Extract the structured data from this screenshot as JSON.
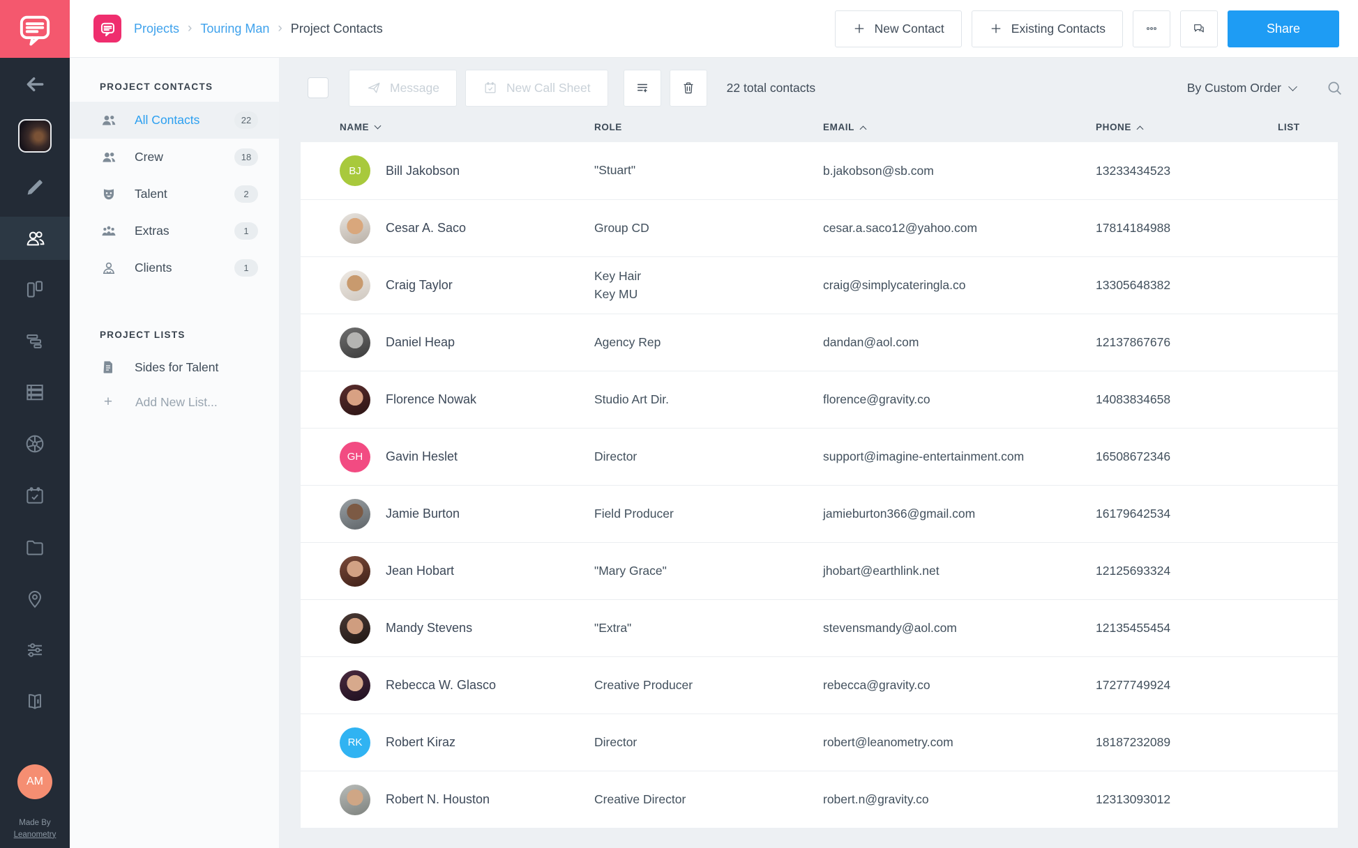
{
  "colors": {
    "brand_pink": "#f4586e",
    "breadcrumb_logo_pink": "#ef2e6e",
    "accent_blue": "#1e9cf4",
    "link_blue": "#3fa2ec",
    "active_filter_blue": "#2b9ff0"
  },
  "header": {
    "breadcrumb": {
      "link1": "Projects",
      "link2": "Touring Man",
      "current": "Project Contacts",
      "separator": "›"
    },
    "new_contact_label": "New Contact",
    "existing_contacts_label": "Existing Contacts",
    "share_label": "Share"
  },
  "left_rail": {
    "icons": [
      "back-arrow",
      "project-thumbnail",
      "pencil",
      "contacts",
      "boards",
      "breakdown",
      "stripboard",
      "shot-list",
      "calendar",
      "files",
      "locations",
      "settings",
      "help-book"
    ],
    "active_icon": "contacts",
    "user_initials": "AM",
    "made_by_line1": "Made By",
    "made_by_line2": "Leanometry"
  },
  "sidebar": {
    "contacts_section_title": "PROJECT CONTACTS",
    "filters": [
      {
        "label": "All Contacts",
        "count": "22",
        "icon": "group",
        "active": true
      },
      {
        "label": "Crew",
        "count": "18",
        "icon": "crew",
        "active": false
      },
      {
        "label": "Talent",
        "count": "2",
        "icon": "talent",
        "active": false
      },
      {
        "label": "Extras",
        "count": "1",
        "icon": "extras",
        "active": false
      },
      {
        "label": "Clients",
        "count": "1",
        "icon": "client",
        "active": false
      }
    ],
    "lists_section_title": "PROJECT LISTS",
    "lists": [
      {
        "label": "Sides for Talent",
        "icon": "document"
      }
    ],
    "add_new_list_plus": "+",
    "add_new_list": "Add New List..."
  },
  "toolbar": {
    "message_label": "Message",
    "new_call_sheet_label": "New Call Sheet",
    "total_text": "22 total contacts",
    "sort_label": "By Custom Order"
  },
  "table": {
    "columns": [
      {
        "label": "NAME",
        "sort": "down"
      },
      {
        "label": "ROLE",
        "sort": ""
      },
      {
        "label": "EMAIL",
        "sort": "up"
      },
      {
        "label": "PHONE",
        "sort": "up"
      },
      {
        "label": "LIST",
        "sort": ""
      }
    ],
    "rows": [
      {
        "name": "Bill Jakobson",
        "role": "\"Stuart\"",
        "email": "b.jakobson@sb.com",
        "phone": "13233434523",
        "list": "",
        "avatar": {
          "type": "initials",
          "text": "BJ",
          "color": "#a8c93c"
        }
      },
      {
        "name": "Cesar A. Saco",
        "role": "Group CD",
        "email": "cesar.a.saco12@yahoo.com",
        "phone": "17814184988",
        "list": "",
        "avatar": {
          "type": "photo",
          "skin": "#d9a77c",
          "bg1": "#e8e4df",
          "bg2": "#b9b0a6"
        }
      },
      {
        "name": "Craig Taylor",
        "role": "Key Hair\nKey MU",
        "email": "craig@simplycateringla.co",
        "phone": "13305648382",
        "list": "",
        "avatar": {
          "type": "photo",
          "skin": "#c89a6e",
          "bg1": "#efeae4",
          "bg2": "#cfc8c0"
        }
      },
      {
        "name": "Daniel Heap",
        "role": "Agency Rep",
        "email": "dandan@aol.com",
        "phone": "12137867676",
        "list": "",
        "avatar": {
          "type": "photo",
          "skin": "#b4b4b2",
          "bg1": "#6f6f6f",
          "bg2": "#3c3c3c"
        }
      },
      {
        "name": "Florence Nowak",
        "role": "Studio Art Dir.",
        "email": "florence@gravity.co",
        "phone": "14083834658",
        "list": "",
        "avatar": {
          "type": "photo",
          "skin": "#d8a183",
          "bg1": "#5a2d2d",
          "bg2": "#2b1414"
        }
      },
      {
        "name": "Gavin Heslet",
        "role": "Director",
        "email": "support@imagine-entertainment.com",
        "phone": "16508672346",
        "list": "",
        "avatar": {
          "type": "initials",
          "text": "GH",
          "color": "#f24b82"
        }
      },
      {
        "name": "Jamie Burton",
        "role": "Field Producer",
        "email": "jamieburton366@gmail.com",
        "phone": "16179642534",
        "list": "",
        "avatar": {
          "type": "photo",
          "skin": "#7c5a44",
          "bg1": "#9aa0a4",
          "bg2": "#5f6569"
        }
      },
      {
        "name": "Jean Hobart",
        "role": "\"Mary Grace\"",
        "email": "jhobart@earthlink.net",
        "phone": "12125693324",
        "list": "",
        "avatar": {
          "type": "photo",
          "skin": "#d2a184",
          "bg1": "#7a4a3a",
          "bg2": "#3f2018"
        }
      },
      {
        "name": "Mandy Stevens",
        "role": "\"Extra\"",
        "email": "stevensmandy@aol.com",
        "phone": "12135455454",
        "list": "",
        "avatar": {
          "type": "photo",
          "skin": "#cf9d7f",
          "bg1": "#4a3a35",
          "bg2": "#201714"
        }
      },
      {
        "name": "Rebecca W. Glasco",
        "role": "Creative Producer",
        "email": "rebecca@gravity.co",
        "phone": "17277749924",
        "list": "",
        "avatar": {
          "type": "photo",
          "skin": "#d7a98c",
          "bg1": "#4a2a3e",
          "bg2": "#1f1020"
        }
      },
      {
        "name": "Robert Kiraz",
        "role": "Director",
        "email": "robert@leanometry.com",
        "phone": "18187232089",
        "list": "",
        "avatar": {
          "type": "initials",
          "text": "RK",
          "color": "#30b3f2"
        }
      },
      {
        "name": "Robert N. Houston",
        "role": "Creative Director",
        "email": "robert.n@gravity.co",
        "phone": "12313093012",
        "list": "",
        "avatar": {
          "type": "photo",
          "skin": "#cfa685",
          "bg1": "#b9bcb9",
          "bg2": "#7e827e"
        }
      }
    ]
  }
}
